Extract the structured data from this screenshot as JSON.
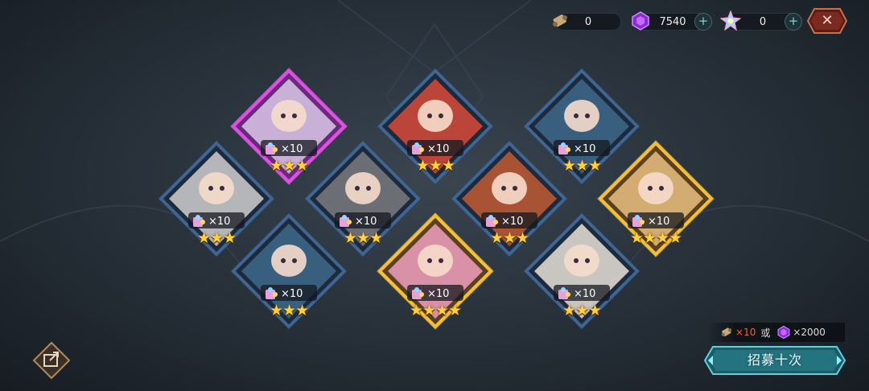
{
  "topbar": {
    "scroll": {
      "icon": "scroll-icon",
      "value": "0"
    },
    "gem": {
      "icon": "purple-gem-icon",
      "value": "7540"
    },
    "crystal": {
      "icon": "rainbow-crystal-icon",
      "value": "0"
    },
    "plus_symbol": "+",
    "close_symbol": "✕"
  },
  "cards": [
    {
      "id": "maid-bunny",
      "rarity": "purple",
      "count": "×10",
      "stars": "★★★",
      "star_count": 3
    },
    {
      "id": "red-hair-maid",
      "rarity": "blue",
      "count": "×10",
      "stars": "★★★",
      "star_count": 3
    },
    {
      "id": "blue-maid-top",
      "rarity": "blue",
      "count": "×10",
      "stars": "★★★",
      "star_count": 3
    },
    {
      "id": "gray-beast",
      "rarity": "blue",
      "count": "×10",
      "stars": "★★★",
      "star_count": 3
    },
    {
      "id": "wolf",
      "rarity": "blue",
      "count": "×10",
      "stars": "★★★",
      "star_count": 3
    },
    {
      "id": "fox",
      "rarity": "blue",
      "count": "×10",
      "stars": "★★★",
      "star_count": 3
    },
    {
      "id": "blonde-girl",
      "rarity": "gold",
      "count": "×10",
      "stars": "★★★★",
      "star_count": 4
    },
    {
      "id": "blue-maid-bottom",
      "rarity": "blue",
      "count": "×10",
      "stars": "★★★",
      "star_count": 3
    },
    {
      "id": "pink-hair-girl",
      "rarity": "gold",
      "count": "×10",
      "stars": "★★★★",
      "star_count": 4
    },
    {
      "id": "white-hair-boy",
      "rarity": "blue",
      "count": "×10",
      "stars": "★★★",
      "star_count": 3
    }
  ],
  "cost": {
    "scroll_amount": "×10",
    "or_text": "或",
    "gem_amount": "×2000"
  },
  "recruit_button": {
    "label": "招募十次"
  },
  "colors": {
    "purple_frame": "#d23fd8",
    "blue_frame": "#34557c",
    "gold_frame": "#f0b020",
    "star": "#ffd040",
    "cost_red": "#ff5a3a"
  }
}
